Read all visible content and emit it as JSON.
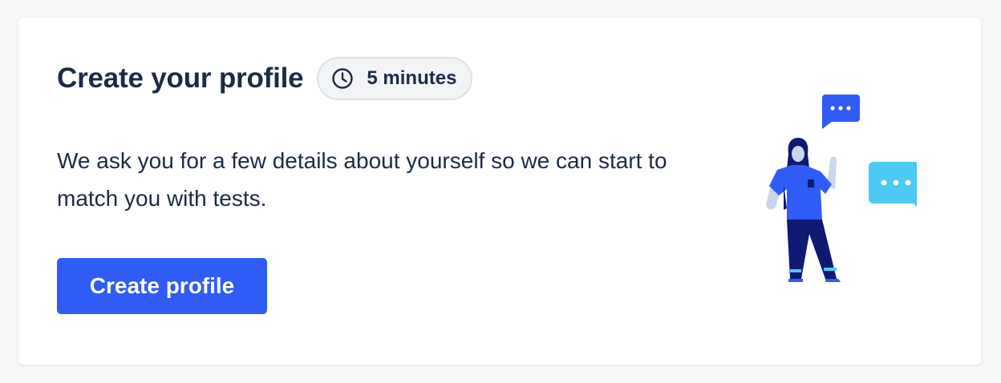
{
  "card": {
    "title": "Create your profile",
    "duration_badge": {
      "icon": "clock-icon",
      "label": "5 minutes"
    },
    "description": "We ask you for a few details about yourself so we can start to match you with tests.",
    "primary_button_label": "Create profile",
    "illustration": "person-with-chat-bubbles"
  },
  "colors": {
    "accent": "#2f5cf6",
    "text": "#1c2b45",
    "badge_border": "#dde1e7",
    "bubble_dark": "#2f5cf6",
    "bubble_light": "#4cc9f5"
  }
}
